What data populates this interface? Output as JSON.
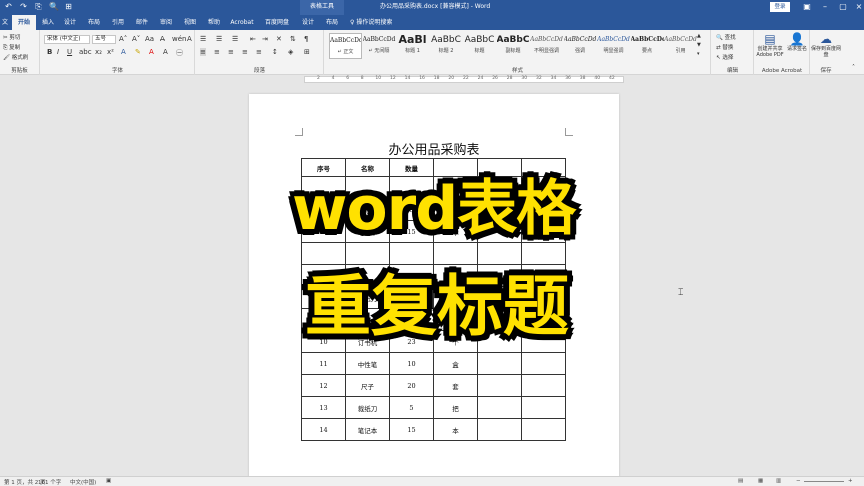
{
  "title_bar": {
    "context_tab": "表格工具",
    "document_title": "办公用品采购表.docx [兼容模式] - Word",
    "login": "登录",
    "quick_access": [
      "↶",
      "↷",
      "⎘",
      "🔍",
      "⊞"
    ]
  },
  "tabs": {
    "file": "文件",
    "home": "开始",
    "insert": "插入",
    "design": "设计",
    "layout": "布局",
    "references": "引用",
    "mailings": "邮件",
    "review": "审阅",
    "view": "视图",
    "help": "帮助",
    "acrobat": "Acrobat",
    "baidu": "百度网盘",
    "table_design": "设计",
    "table_layout": "布局",
    "tell_me": "操作说明搜索"
  },
  "ribbon": {
    "clipboard": {
      "label": "剪贴板",
      "cut": "剪切",
      "copy": "复制",
      "format_painter": "格式刷"
    },
    "font": {
      "label": "字体",
      "font_name": "宋体 (中文正)",
      "font_size": "五号"
    },
    "paragraph": {
      "label": "段落"
    },
    "styles": {
      "label": "样式",
      "items": [
        {
          "sample": "AaBbCcDd",
          "name": "↵ 正文"
        },
        {
          "sample": "AaBbCcDd",
          "name": "↵ 无间隔"
        },
        {
          "sample": "AaBl",
          "name": "标题 1"
        },
        {
          "sample": "AaBbC",
          "name": "标题 2"
        },
        {
          "sample": "AaBbC",
          "name": "标题"
        },
        {
          "sample": "AaBbC",
          "name": "副标题"
        },
        {
          "sample": "AaBbCcDd",
          "name": "不明显强调"
        },
        {
          "sample": "AaBbCcDd",
          "name": "强调"
        },
        {
          "sample": "AaBbCcDd",
          "name": "明显强调"
        },
        {
          "sample": "AaBbCcDd",
          "name": "要点"
        },
        {
          "sample": "AaBbCcDd",
          "name": "引用"
        }
      ]
    },
    "editing": {
      "label": "编辑",
      "find": "查找",
      "replace": "替换",
      "select": "选择"
    },
    "acrobat": {
      "label": "Adobe Acrobat",
      "create_share": "创建并共享 Adobe PDF",
      "request_sign": "请求签名"
    },
    "save": {
      "label": "保存",
      "save_baidu": "保存到百度网盘"
    }
  },
  "ruler": {
    "ticks": [
      "2",
      "4",
      "6",
      "8",
      "10",
      "12",
      "14",
      "16",
      "18",
      "20",
      "22",
      "24",
      "26",
      "28",
      "30",
      "32",
      "34",
      "36",
      "38",
      "40",
      "42"
    ]
  },
  "document": {
    "heading": "办公用品采购表",
    "table_headers": [
      "序号",
      "名称",
      "数量",
      "",
      "",
      ""
    ],
    "rows": [
      [
        "",
        "",
        "",
        "",
        "",
        ""
      ],
      [
        "3",
        "裁纸刀",
        "5",
        "把",
        "",
        ""
      ],
      [
        "4",
        "笔记本",
        "15",
        "本",
        "",
        ""
      ],
      [
        "",
        "",
        "",
        "",
        "",
        ""
      ],
      [
        "",
        "",
        "",
        "",
        "",
        ""
      ],
      [
        "8",
        "裁纸刀",
        "5",
        "把",
        "",
        ""
      ],
      [
        "9",
        "笔记本",
        "15",
        "本",
        "",
        ""
      ],
      [
        "10",
        "订书机",
        "23",
        "个",
        "",
        ""
      ],
      [
        "11",
        "中性笔",
        "10",
        "盒",
        "",
        ""
      ],
      [
        "12",
        "尺子",
        "20",
        "套",
        "",
        ""
      ],
      [
        "13",
        "裁纸刀",
        "5",
        "把",
        "",
        ""
      ],
      [
        "14",
        "笔记本",
        "15",
        "本",
        "",
        ""
      ]
    ]
  },
  "overlay": {
    "line1": "word表格",
    "line2": "重复标题"
  },
  "status": {
    "pages": "第 1 页，共 2 页",
    "words": "161 个字",
    "language": "中文(中国)"
  }
}
